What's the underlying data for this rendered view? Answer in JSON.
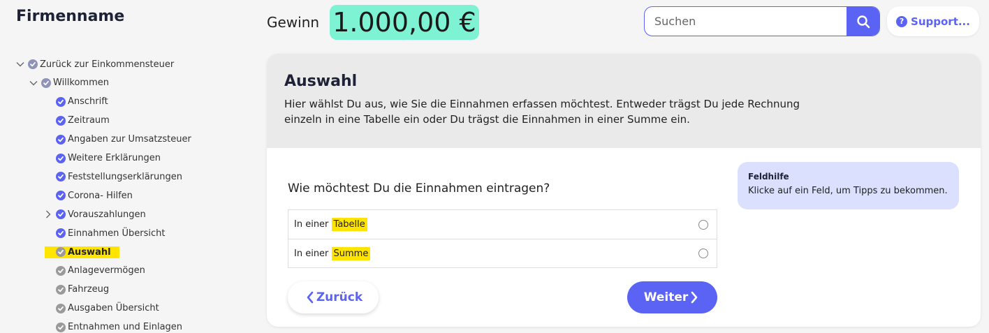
{
  "company_name": "Firmenname",
  "profit": {
    "label": "Gewinn",
    "value": "1.000,00 €"
  },
  "search": {
    "placeholder": "Suchen"
  },
  "support": {
    "label": "Support..."
  },
  "nav": {
    "items": [
      {
        "label": "Zurück zur Einkommensteuer",
        "level": 0,
        "chevron": "down",
        "state": "parent"
      },
      {
        "label": "Willkommen",
        "level": 1,
        "chevron": "down",
        "state": "parent"
      },
      {
        "label": "Anschrift",
        "level": 2,
        "chevron": "none",
        "state": "done"
      },
      {
        "label": "Zeitraum",
        "level": 2,
        "chevron": "none",
        "state": "done"
      },
      {
        "label": "Angaben zur Umsatzsteuer",
        "level": 2,
        "chevron": "none",
        "state": "done"
      },
      {
        "label": "Weitere Erklärungen",
        "level": 2,
        "chevron": "none",
        "state": "done"
      },
      {
        "label": "Feststellungserklärungen",
        "level": 2,
        "chevron": "none",
        "state": "done"
      },
      {
        "label": "Corona- Hilfen",
        "level": 2,
        "chevron": "none",
        "state": "done"
      },
      {
        "label": "Vorauszahlungen",
        "level": 2,
        "chevron": "right",
        "state": "done"
      },
      {
        "label": "Einnahmen Übersicht",
        "level": 2,
        "chevron": "none",
        "state": "done"
      },
      {
        "label": "Auswahl",
        "level": 2,
        "chevron": "none",
        "state": "active"
      },
      {
        "label": "Anlagevermögen",
        "level": 2,
        "chevron": "none",
        "state": "pending"
      },
      {
        "label": "Fahrzeug",
        "level": 2,
        "chevron": "none",
        "state": "pending"
      },
      {
        "label": "Ausgaben Übersicht",
        "level": 2,
        "chevron": "none",
        "state": "pending"
      },
      {
        "label": "Entnahmen und Einlagen",
        "level": 2,
        "chevron": "none",
        "state": "pending"
      }
    ]
  },
  "main": {
    "title": "Auswahl",
    "description": "Hier wählst Du aus, wie Sie die Einnahmen erfassen möchtest. Entweder trägst Du jede Rechnung einzeln in eine Tabelle ein oder Du trägst die Einnahmen in einer Summe ein.",
    "question": "Wie möchtest Du die Einnahmen eintragen?",
    "options": [
      {
        "prefix": "In einer ",
        "highlight": "Tabelle"
      },
      {
        "prefix": "In einer ",
        "highlight": "Summe"
      }
    ],
    "back_label": "Zurück",
    "next_label": "Weiter"
  },
  "help": {
    "title": "Feldhilfe",
    "text": "Klicke auf ein Feld, um Tipps zu bekommen."
  },
  "colors": {
    "accent": "#5b63f5",
    "profit_bg": "#7df3d3",
    "highlight": "#ffe400",
    "help_bg": "#dbe0ff",
    "done": "#5b63f5",
    "pending": "#9a9a9a"
  }
}
